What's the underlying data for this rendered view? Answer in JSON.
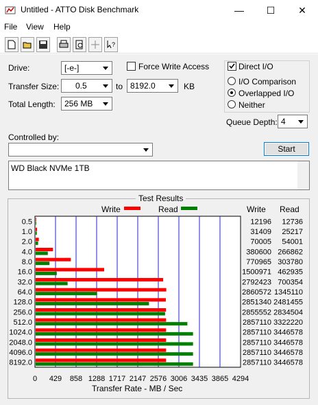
{
  "window": {
    "title": "Untitled - ATTO Disk Benchmark"
  },
  "menu": {
    "file": "File",
    "view": "View",
    "help": "Help"
  },
  "toolbar": {
    "icons": [
      "new-document-icon",
      "open-folder-icon",
      "save-icon",
      "print-icon",
      "print-preview-icon",
      "move-icon",
      "context-help-icon"
    ]
  },
  "settings": {
    "drive_label": "Drive:",
    "drive_value": "[-e-]",
    "transfer_size_label": "Transfer Size:",
    "transfer_from": "0.5",
    "to_label": "to",
    "transfer_to": "8192.0",
    "kb_label": "KB",
    "total_length_label": "Total Length:",
    "total_length_value": "256 MB",
    "force_write_label": "Force Write Access",
    "direct_io_label": "Direct I/O",
    "io_comparison_label": "I/O Comparison",
    "overlapped_io_label": "Overlapped I/O",
    "neither_label": "Neither",
    "queue_depth_label": "Queue Depth:",
    "queue_depth_value": "4",
    "controlled_by_label": "Controlled by:",
    "controlled_by_value": "",
    "start_label": "Start",
    "description": "WD Black NVMe 1TB",
    "force_write_checked": false,
    "direct_io_checked": true,
    "selected_mode": "Overlapped I/O"
  },
  "results": {
    "group_title": "Test Results",
    "legend_write": "Write",
    "legend_read": "Read",
    "col_write": "Write",
    "col_read": "Read",
    "xlabel": "Transfer Rate - MB / Sec",
    "write_color": "#ff0000",
    "read_color": "#008000"
  },
  "chart_data": {
    "type": "bar",
    "orientation": "horizontal",
    "xlabel": "Transfer Rate - MB / Sec",
    "xlim": [
      0,
      4294
    ],
    "x_ticks": [
      "0",
      "429",
      "858",
      "1288",
      "1717",
      "2147",
      "2576",
      "3006",
      "3435",
      "3865",
      "4294"
    ],
    "grid": true,
    "categories": [
      "0.5",
      "1.0",
      "2.0",
      "4.0",
      "8.0",
      "16.0",
      "32.0",
      "64.0",
      "128.0",
      "256.0",
      "512.0",
      "1024.0",
      "2048.0",
      "4096.0",
      "8192.0"
    ],
    "series": [
      {
        "name": "Write",
        "color": "#ff0000",
        "values": [
          11.6,
          30.0,
          66.8,
          363.0,
          735.3,
          1431.3,
          2663.4,
          2728.2,
          2719.2,
          2723.4,
          2724.7,
          2724.7,
          2724.7,
          2724.7,
          2724.7
        ]
      },
      {
        "name": "Read",
        "color": "#008000",
        "values": [
          12.1,
          24.0,
          51.5,
          254.6,
          289.7,
          441.5,
          667.9,
          1283.7,
          2367.6,
          2703.4,
          3168.9,
          3287.0,
          3287.0,
          3287.0,
          3287.0
        ]
      }
    ],
    "write_text": [
      "12196",
      "31409",
      "70005",
      "380600",
      "770965",
      "1500971",
      "2792423",
      "2860572",
      "2851340",
      "2855552",
      "2857110",
      "2857110",
      "2857110",
      "2857110",
      "2857110"
    ],
    "read_text": [
      "12736",
      "25217",
      "54001",
      "266862",
      "303780",
      "462935",
      "700354",
      "1345110",
      "2481455",
      "2834504",
      "3322220",
      "3446578",
      "3446578",
      "3446578",
      "3446578"
    ]
  }
}
